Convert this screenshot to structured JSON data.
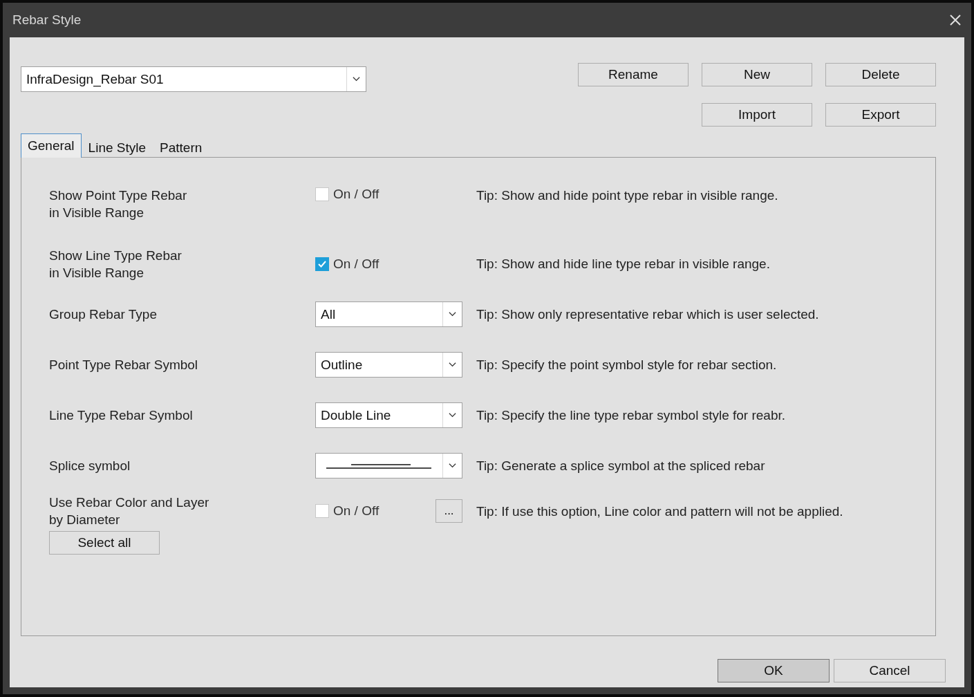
{
  "window": {
    "title": "Rebar Style"
  },
  "style_select": {
    "value": "InfraDesign_Rebar S01"
  },
  "top_buttons": [
    {
      "label": "Rename"
    },
    {
      "label": "New"
    },
    {
      "label": "Delete"
    },
    {
      "label": "Import"
    },
    {
      "label": "Export"
    }
  ],
  "tabs": [
    {
      "label": "General",
      "selected": true
    },
    {
      "label": "Line Style",
      "selected": false
    },
    {
      "label": "Pattern",
      "selected": false
    }
  ],
  "rows": [
    {
      "kind": "toggle",
      "label": "Show Point Type Rebar\nin Visible Range",
      "checked": false,
      "toggle_label": "On / Off",
      "tip": "Tip: Show and hide point type rebar in visible range."
    },
    {
      "kind": "toggle",
      "label": "Show Line Type Rebar\nin Visible Range",
      "checked": true,
      "toggle_label": "On / Off",
      "tip": "Tip: Show and hide line type rebar in visible range."
    },
    {
      "kind": "select",
      "label": "Group Rebar Type",
      "value": "All",
      "tip": "Tip: Show only representative rebar which is user selected."
    },
    {
      "kind": "select",
      "label": "Point Type Rebar Symbol",
      "value": "Outline",
      "tip": "Tip: Specify the point symbol style for rebar section."
    },
    {
      "kind": "select",
      "label": "Line Type Rebar Symbol",
      "value": "Double Line",
      "tip": "Tip: Specify the line type rebar symbol style for reabr."
    },
    {
      "kind": "splice",
      "label": "Splice symbol",
      "tip": "Tip: Generate a splice symbol at the spliced rebar"
    },
    {
      "kind": "toggle",
      "label": "Use Rebar Color and Layer\nby Diameter",
      "checked": false,
      "toggle_label": "On / Off",
      "extra_button": "...",
      "tip": "Tip: If use this option, Line color and pattern will not be applied."
    }
  ],
  "select_all": {
    "label": "Select all"
  },
  "footer_buttons": [
    {
      "label": "OK",
      "selected": true
    },
    {
      "label": "Cancel",
      "selected": false
    }
  ]
}
